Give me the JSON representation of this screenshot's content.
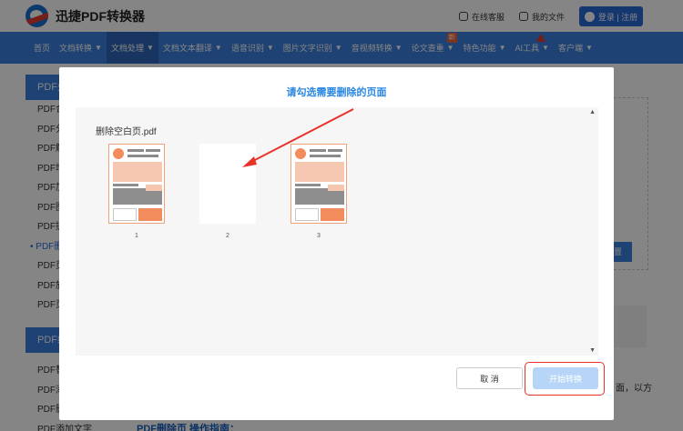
{
  "header": {
    "logo_text": "迅捷PDF转换器",
    "links": {
      "service": "在线客服",
      "files": "我的文件",
      "login": "登录 | 注册"
    }
  },
  "nav": {
    "items": [
      {
        "label": "首页",
        "caret": false
      },
      {
        "label": "文档转换",
        "caret": true
      },
      {
        "label": "文档处理",
        "caret": true
      },
      {
        "label": "文档文本翻译",
        "caret": true
      },
      {
        "label": "语音识别",
        "caret": true
      },
      {
        "label": "图片文字识别",
        "caret": true
      },
      {
        "label": "音视频转换",
        "caret": true
      },
      {
        "label": "论文查重",
        "caret": true,
        "badge": "新"
      },
      {
        "label": "特色功能",
        "caret": true
      },
      {
        "label": "AI工具",
        "caret": true
      },
      {
        "label": "客户端",
        "caret": true
      }
    ]
  },
  "sidebar": {
    "head": "PDF处",
    "items": [
      "PDF合",
      "PDF分",
      "PDF解",
      "PDF增",
      "PDF加",
      "PDF图",
      "PDF提",
      "PDF删",
      "PDF页",
      "PDF旋",
      "PDF页"
    ],
    "active_index": 7,
    "head2": "PDF编",
    "items2": [
      "PDF替",
      "PDF添",
      "PDF删",
      "PDF添加文字"
    ]
  },
  "background": {
    "right_button": "置",
    "right_text": "面，以方",
    "guide": "PDF删除页 操作指南："
  },
  "modal": {
    "title": "请勾选需要删除的页面",
    "file_name": "删除空白页.pdf",
    "pages": [
      {
        "number": "1",
        "blank": false,
        "selected": true
      },
      {
        "number": "2",
        "blank": true,
        "selected": false
      },
      {
        "number": "3",
        "blank": false,
        "selected": true
      }
    ],
    "cancel_label": "取 消",
    "start_label": "开始转换"
  },
  "colors": {
    "brand_blue": "#3b7fdc",
    "title_blue": "#2a87e0",
    "accent_orange": "#f28c5c",
    "highlight_red": "#e8332a"
  },
  "icons": {
    "scroll_up": "▲",
    "scroll_down": "▼",
    "caret": "▼"
  }
}
